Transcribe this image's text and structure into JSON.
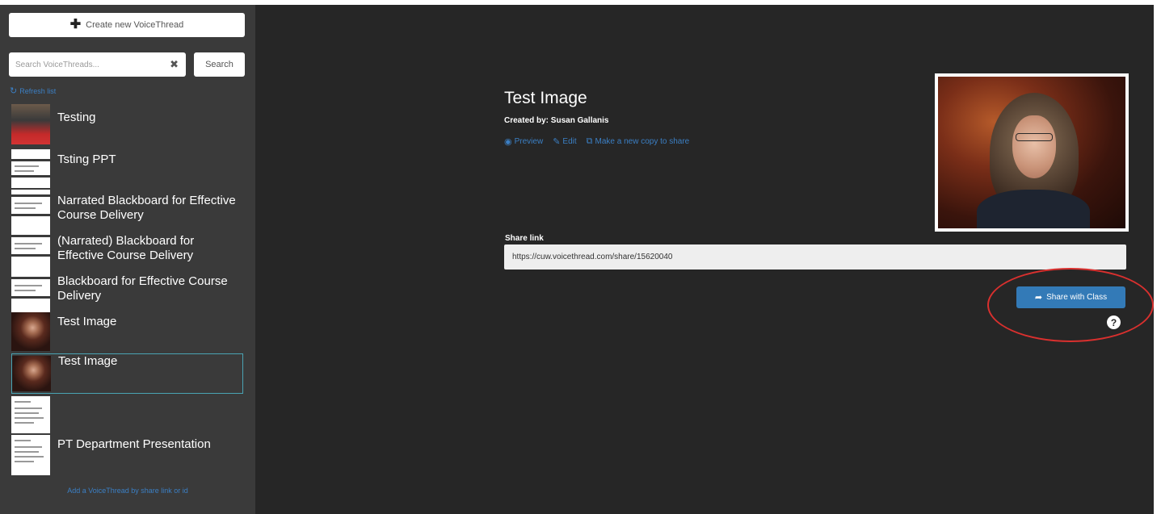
{
  "sidebar": {
    "create_label": "Create new VoiceThread",
    "search": {
      "placeholder": "Search VoiceThreads...",
      "clear_icon": "✖",
      "button_label": "Search"
    },
    "refresh_label": "Refresh list",
    "add_link": "Add a VoiceThread by share link or id",
    "threads": [
      {
        "title": "Testing",
        "thumb": "photo"
      },
      {
        "title": "Tsting PPT",
        "thumb": "doc"
      },
      {
        "title": "Narrated Blackboard for Effective Course Delivery",
        "thumb": "doc"
      },
      {
        "title": "(Narrated) Blackboard for Effective Course Delivery",
        "thumb": "doc"
      },
      {
        "title": "Blackboard for Effective Course Delivery",
        "thumb": "doc"
      },
      {
        "title": "Test Image",
        "thumb": "woman"
      },
      {
        "title": "Test Image",
        "thumb": "woman",
        "selected": true
      },
      {
        "title": "",
        "thumb": "doc"
      },
      {
        "title": "PT Department Presentation",
        "thumb": "doc"
      }
    ]
  },
  "main": {
    "title": "Test Image",
    "created_by": "Created by: Susan Gallanis",
    "actions": [
      {
        "label": "Preview",
        "icon": "eye-icon"
      },
      {
        "label": "Edit",
        "icon": "edit-icon"
      },
      {
        "label": "Make a new copy to share",
        "icon": "copy-icon"
      }
    ],
    "share_label": "Share link",
    "share_url": "https://cuw.voicethread.com/share/15620040",
    "share_button": "Share with Class",
    "help": "?"
  },
  "colors": {
    "sidebar_bg": "#3a3a3a",
    "main_bg": "#262626",
    "link": "#3b7fc4",
    "accent": "#337ab7",
    "annotation": "#d9302e"
  }
}
